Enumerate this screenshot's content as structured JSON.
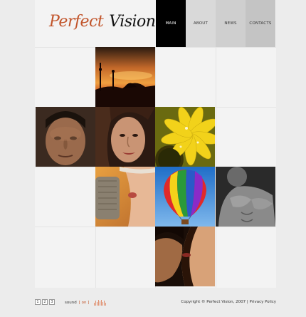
{
  "logo": {
    "word1": "Perfect",
    "word2": "Vision"
  },
  "nav": [
    {
      "label": "MAIN",
      "active": true
    },
    {
      "label": "ABOUT"
    },
    {
      "label": "NEWS"
    },
    {
      "label": "CONTACTS"
    }
  ],
  "tiles": [
    {
      "name": "sunset-silhouette-photo"
    },
    {
      "name": "man-portrait-photo"
    },
    {
      "name": "woman-portrait-photo"
    },
    {
      "name": "yellow-flower-photo"
    },
    {
      "name": "woman-microphone-photo"
    },
    {
      "name": "hot-air-balloon-photo"
    },
    {
      "name": "muscular-torso-photo"
    },
    {
      "name": "couple-kiss-photo"
    }
  ],
  "footer": {
    "pages": [
      "1",
      "2",
      "3"
    ],
    "sound_label": "sound",
    "sound_state": "[ on ]",
    "copyright": "Copyright © Perfect Vision,  2007",
    "separator": "|",
    "privacy": "Privacy Policy"
  },
  "colors": {
    "accent": "#c1542a",
    "active_nav": "#000000"
  }
}
